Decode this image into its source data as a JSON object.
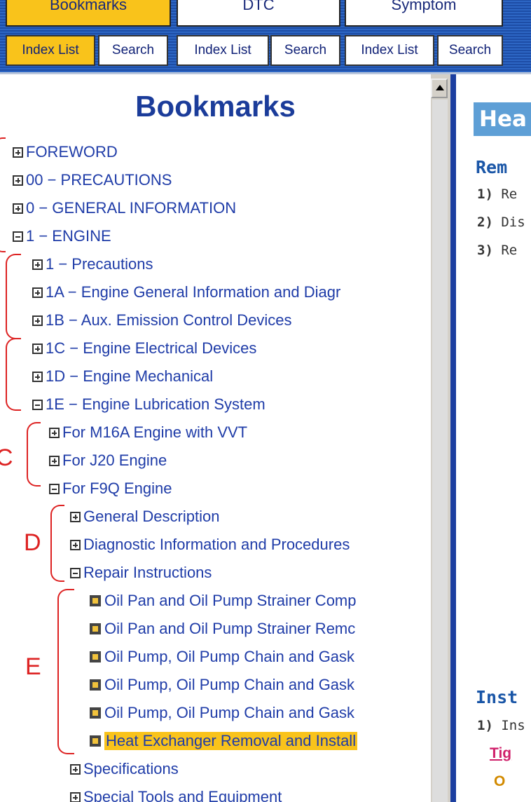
{
  "tabs": {
    "main": [
      "Bookmarks",
      "DTC",
      "Symptom"
    ],
    "sub": [
      "Index List",
      "Search",
      "Index List",
      "Search",
      "Index List",
      "Search"
    ]
  },
  "bookmarks": {
    "title": "Bookmarks",
    "items": [
      {
        "icon": "plus",
        "label": "FOREWORD"
      },
      {
        "icon": "plus",
        "label": "00 − PRECAUTIONS"
      },
      {
        "icon": "plus",
        "label": "0 − GENERAL INFORMATION"
      },
      {
        "icon": "minus",
        "label": "1 − ENGINE"
      },
      {
        "icon": "plus",
        "label": "1 − Precautions"
      },
      {
        "icon": "plus",
        "label": "1A − Engine General Information and Diagr"
      },
      {
        "icon": "plus",
        "label": "1B − Aux. Emission Control Devices"
      },
      {
        "icon": "plus",
        "label": "1C − Engine Electrical Devices"
      },
      {
        "icon": "plus",
        "label": "1D − Engine Mechanical"
      },
      {
        "icon": "minus",
        "label": "1E − Engine Lubrication System"
      },
      {
        "icon": "plus",
        "label": "For M16A Engine with VVT"
      },
      {
        "icon": "plus",
        "label": "For J20 Engine"
      },
      {
        "icon": "minus",
        "label": "For F9Q Engine"
      },
      {
        "icon": "plus",
        "label": "General Description"
      },
      {
        "icon": "plus",
        "label": "Diagnostic Information and Procedures"
      },
      {
        "icon": "minus",
        "label": "Repair Instructions"
      },
      {
        "icon": "doc",
        "label": "Oil Pan and Oil Pump Strainer Comp"
      },
      {
        "icon": "doc",
        "label": "Oil Pan and Oil Pump Strainer Remc"
      },
      {
        "icon": "doc",
        "label": "Oil Pump, Oil Pump Chain and Gask"
      },
      {
        "icon": "doc",
        "label": "Oil Pump, Oil Pump Chain and Gask"
      },
      {
        "icon": "doc",
        "label": "Oil Pump, Oil Pump Chain and Gask"
      },
      {
        "icon": "doc",
        "label": "Heat Exchanger Removal and Install",
        "selected": true
      },
      {
        "icon": "plus",
        "label": "Specifications"
      },
      {
        "icon": "plus",
        "label": "Special Tools and Equipment"
      }
    ]
  },
  "annotations": [
    "C",
    "D",
    "E"
  ],
  "right": {
    "heading": "Hea",
    "sub1": "Rem",
    "steps": [
      {
        "n": "1)",
        "t": "Re"
      },
      {
        "n": "2)",
        "t": "Dis"
      },
      {
        "n": "3)",
        "t": "Re"
      }
    ],
    "sub2": "Inst",
    "step_install": {
      "n": "1)",
      "t": "Ins"
    },
    "tight": "Tig",
    "o": "O"
  },
  "colors": {
    "accent": "#f9c31b",
    "link": "#1f3ca8",
    "annotation": "#dd2222",
    "header_bg": "#5e9fd6"
  }
}
